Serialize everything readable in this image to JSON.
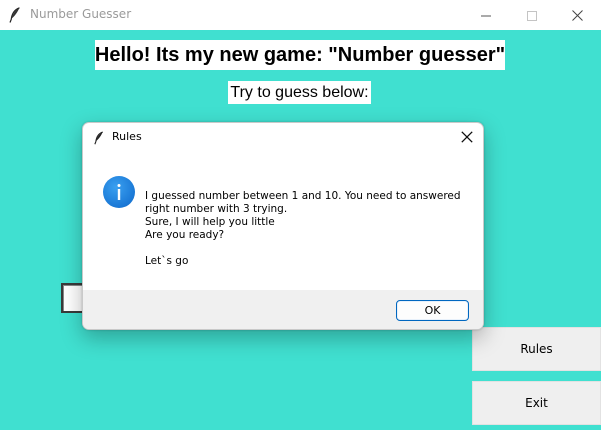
{
  "window": {
    "title": "Number Guesser",
    "background_color": "#40e0d0",
    "controls": [
      "minimize-icon",
      "maximize-icon",
      "close-icon"
    ]
  },
  "main": {
    "headline": "Hello! Its my new game: \"Number guesser\"",
    "subline": "Try to guess below:",
    "guess_entry_value": ""
  },
  "buttons": {
    "rules": "Rules",
    "exit": "Exit"
  },
  "dialog": {
    "title": "Rules",
    "icon": "info-icon",
    "message_lines": [
      "I guessed number between 1 and 10. You need to answered",
      "right number with 3 trying.",
      "Sure, I will help you little",
      "Are you ready?",
      "",
      "Let`s go"
    ],
    "ok_label": "OK",
    "accent_color": "#0067c0"
  }
}
